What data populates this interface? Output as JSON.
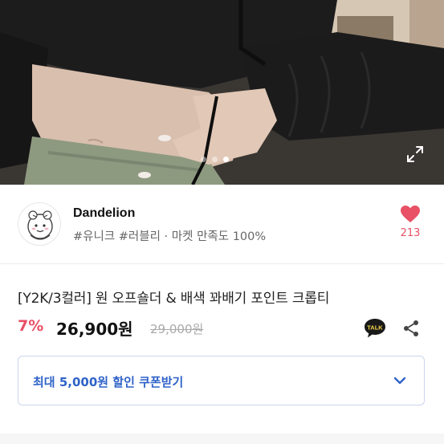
{
  "hero": {
    "slide_count": 3,
    "active_slide": 3,
    "colors": {
      "garment": "#1c1c1c",
      "skin": "#d9bfae",
      "pants": "#8e9a80",
      "background": "#b9a48f"
    }
  },
  "shop": {
    "name": "Dandelion",
    "tags": "#유니크 #러블리 · 마켓 만족도 100%",
    "like_count": "213",
    "like_color": "#e85166"
  },
  "product": {
    "title": "[Y2K/3컬러] 원 오프숄더 & 배색 꽈배기 포인트 크롭티",
    "discount": "7%",
    "price": "26,900원",
    "original_price": "29,000원",
    "talk_label": "TALK"
  },
  "coupon": {
    "label": "최대 5,000원 할인 쿠폰받기",
    "accent": "#2f63c8"
  }
}
